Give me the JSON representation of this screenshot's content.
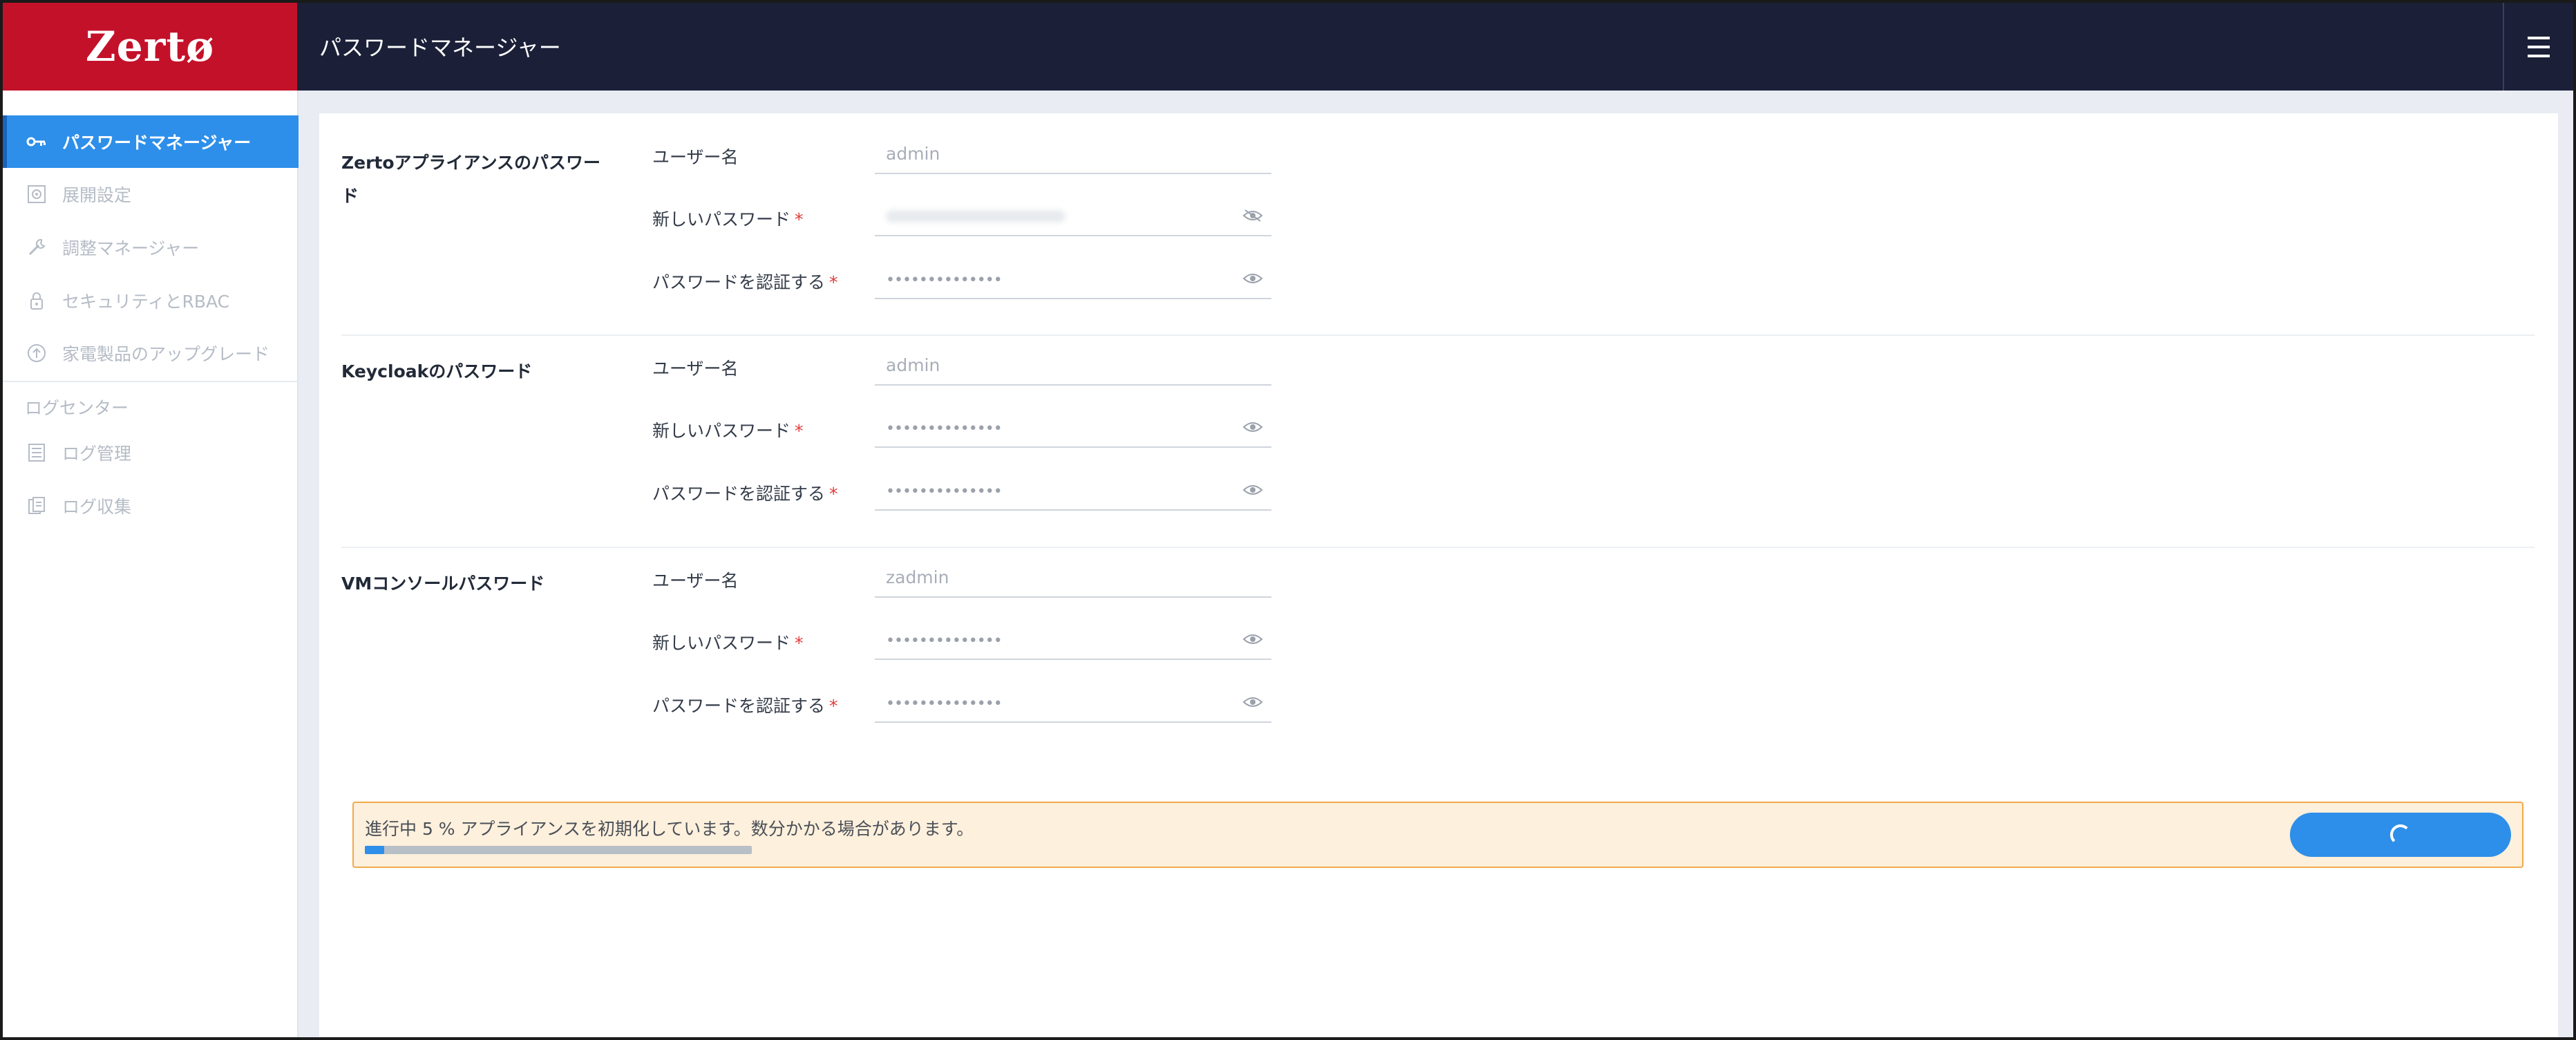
{
  "brand": {
    "logo_text": "Zertø",
    "logo_color": "#c4112a"
  },
  "header": {
    "title": "パスワードマネージャー",
    "menu_icon": "hamburger-icon"
  },
  "sidebar": {
    "items": [
      {
        "label": "パスワードマネージャー",
        "icon": "key-icon",
        "active": true
      },
      {
        "label": "展開設定",
        "icon": "settings-icon",
        "active": false
      },
      {
        "label": "調整マネージャー",
        "icon": "wrench-icon",
        "active": false
      },
      {
        "label": "セキュリティとRBAC",
        "icon": "lock-icon",
        "active": false
      },
      {
        "label": "家電製品のアップグレード",
        "icon": "upgrade-icon",
        "active": false
      }
    ],
    "group_label": "ログセンター",
    "group_items": [
      {
        "label": "ログ管理",
        "icon": "list-icon"
      },
      {
        "label": "ログ収集",
        "icon": "files-icon"
      }
    ]
  },
  "sections": [
    {
      "title": "Zertoアプライアンスのパスワード",
      "username_label": "ユーザー名",
      "username_value": "admin",
      "new_password_label": "新しいパスワード",
      "new_password_visible": true,
      "new_password_icon": "eye-off-icon",
      "confirm_label": "パスワードを認証する",
      "confirm_value": "••••••••••••••",
      "confirm_icon": "eye-icon"
    },
    {
      "title": "Keycloakのパスワード",
      "username_label": "ユーザー名",
      "username_value": "admin",
      "new_password_label": "新しいパスワード",
      "new_password_value": "••••••••••••••",
      "new_password_icon": "eye-icon",
      "confirm_label": "パスワードを認証する",
      "confirm_value": "••••••••••••••",
      "confirm_icon": "eye-icon"
    },
    {
      "title": "VMコンソールパスワード",
      "username_label": "ユーザー名",
      "username_value": "zadmin",
      "new_password_label": "新しいパスワード",
      "new_password_value": "••••••••••••••",
      "new_password_icon": "eye-icon",
      "confirm_label": "パスワードを認証する",
      "confirm_value": "••••••••••••••",
      "confirm_icon": "eye-icon"
    }
  ],
  "required_marker": "*",
  "progress": {
    "text": "進行中 5 % アプライアンスを初期化しています。数分かかる場合があります。",
    "percent": 5,
    "button_icon": "spinner-icon"
  },
  "colors": {
    "accent": "#2d8fe9",
    "header_bg": "#1b2038",
    "warning_bg": "#fdf0dc",
    "warning_border": "#f0a94a"
  }
}
